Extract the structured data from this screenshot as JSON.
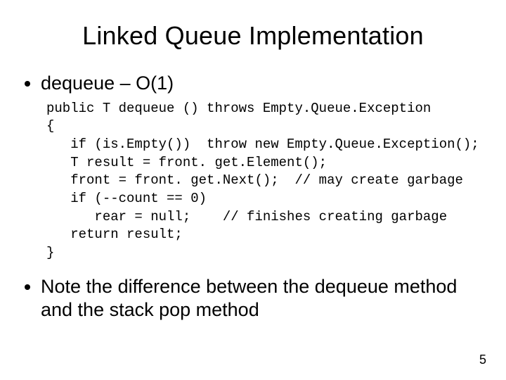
{
  "title": "Linked Queue Implementation",
  "bullets": {
    "first": "dequeue – O(1)",
    "second": "Note the difference between the dequeue method and the stack pop method"
  },
  "code": {
    "l1": "public T dequeue () throws Empty.Queue.Exception",
    "l2": "{",
    "l3": "   if (is.Empty())  throw new Empty.Queue.Exception();",
    "l4": "   T result = front. get.Element();",
    "l5": "   front = front. get.Next();  // may create garbage",
    "l6": "   if (--count == 0)",
    "l7": "      rear = null;    // finishes creating garbage",
    "l8": "   return result;",
    "l9": "}"
  },
  "page_number": "5"
}
